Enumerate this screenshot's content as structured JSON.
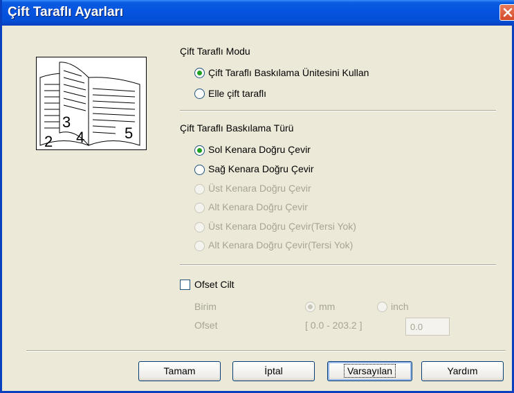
{
  "window": {
    "title": "Çift Taraflı Ayarları",
    "close_icon": "close-icon"
  },
  "duplex_mode": {
    "heading": "Çift Taraflı Modu",
    "options": [
      {
        "label": "Çift Taraflı Baskılama Ünitesini Kullan",
        "selected": true,
        "enabled": true
      },
      {
        "label": "Elle çift taraflı",
        "selected": false,
        "enabled": true
      }
    ]
  },
  "duplex_type": {
    "heading": "Çift Taraflı Baskılama Türü",
    "options": [
      {
        "label": "Sol Kenara Doğru Çevir",
        "selected": true,
        "enabled": true
      },
      {
        "label": "Sağ Kenara Doğru Çevir",
        "selected": false,
        "enabled": true
      },
      {
        "label": "Üst Kenara Doğru Çevir",
        "selected": false,
        "enabled": false
      },
      {
        "label": "Alt Kenara Doğru Çevir",
        "selected": false,
        "enabled": false
      },
      {
        "label": "Üst Kenara Doğru Çevir(Tersi Yok)",
        "selected": false,
        "enabled": false
      },
      {
        "label": "Alt Kenara Doğru Çevir(Tersi Yok)",
        "selected": false,
        "enabled": false
      }
    ]
  },
  "binding_offset": {
    "checkbox_label": "Ofset Cilt",
    "checked": false,
    "unit_label": "Birim",
    "unit_options": [
      {
        "label": "mm",
        "selected": true
      },
      {
        "label": "inch",
        "selected": false
      }
    ],
    "offset_label": "Ofset",
    "offset_range": "[ 0.0 - 203.2 ]",
    "offset_value": "0.0"
  },
  "preview": {
    "pages": [
      "2",
      "3",
      "4",
      "5"
    ],
    "icon": "book-preview-icon"
  },
  "buttons": {
    "ok": "Tamam",
    "cancel": "İptal",
    "default": "Varsayılan",
    "help": "Yardım"
  }
}
